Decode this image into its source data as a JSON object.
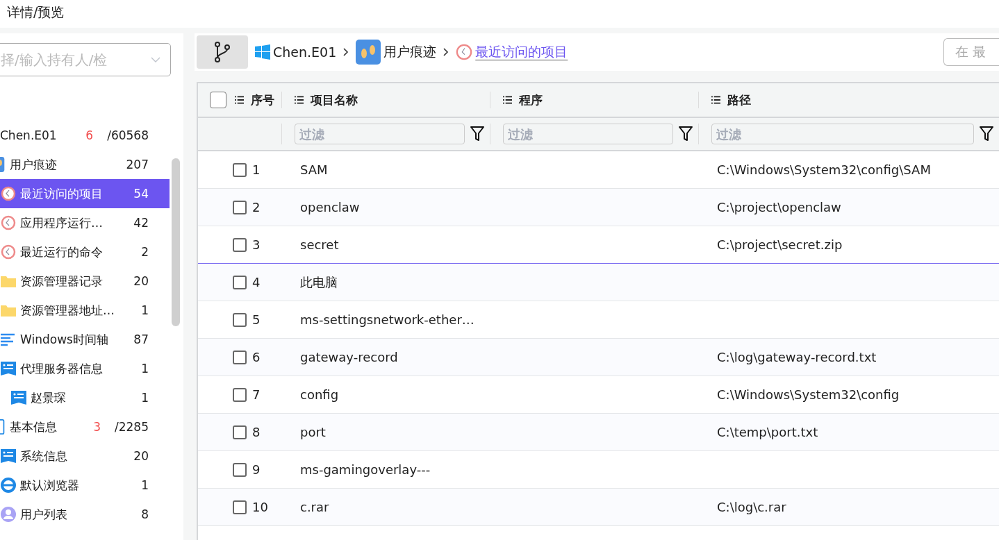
{
  "top_tab": {
    "label": "详情/预览"
  },
  "sidebar": {
    "select": {
      "placeholder": "择/输入持有人/检"
    },
    "tree": [
      {
        "label": "Chen.E01",
        "count_highlight": "6",
        "count": "/60568",
        "selected": false,
        "children": [
          {
            "label": "用户痕迹",
            "count": "207",
            "kind": "footprint",
            "selected": false,
            "children": [
              {
                "label": "最近访问的项目",
                "count": "54",
                "kind": "clock",
                "selected": true
              },
              {
                "label": "应用程序运行…",
                "count": "42",
                "kind": "clock",
                "selected": false
              },
              {
                "label": "最近运行的命令",
                "count": "2",
                "kind": "clock",
                "selected": false
              },
              {
                "label": "资源管理器记录",
                "count": "20",
                "kind": "folder",
                "selected": false
              },
              {
                "label": "资源管理器地址…",
                "count": "1",
                "kind": "folder",
                "selected": false
              },
              {
                "label": "Windows时间轴",
                "count": "87",
                "kind": "timeline",
                "selected": false
              },
              {
                "label": "代理服务器信息",
                "count": "1",
                "kind": "card",
                "selected": false,
                "children": [
                  {
                    "label": "赵景琛",
                    "count": "1",
                    "kind": "card",
                    "selected": false
                  }
                ]
              }
            ]
          },
          {
            "label": "基本信息",
            "count_highlight": "3",
            "count": "/2285",
            "kind": "frame",
            "selected": false,
            "children": [
              {
                "label": "系统信息",
                "count": "20",
                "kind": "card",
                "selected": false
              },
              {
                "label": "默认浏览器",
                "count": "1",
                "kind": "browser",
                "selected": false
              },
              {
                "label": "用户列表",
                "count": "8",
                "kind": "user",
                "selected": false
              }
            ]
          }
        ]
      }
    ]
  },
  "breadcrumb": [
    {
      "label": "Chen.E01",
      "kind": "windows",
      "current": false
    },
    {
      "label": "用户痕迹",
      "kind": "footprint",
      "current": false
    },
    {
      "label": "最近访问的项目",
      "kind": "clock",
      "current": true
    }
  ],
  "search": {
    "placeholder": "在 最"
  },
  "table": {
    "columns": [
      "序号",
      "项目名称",
      "程序",
      "路径"
    ],
    "all_checked": false,
    "filter_placeholders": [
      "过滤",
      "过滤",
      "过滤"
    ],
    "rows": [
      {
        "index": "1",
        "name": "SAM",
        "path": "C:\\Windows\\System32\\config\\SAM",
        "checked": false,
        "hovered": false
      },
      {
        "index": "2",
        "name": "openclaw",
        "path": "C:\\project\\openclaw",
        "checked": false,
        "hovered": false
      },
      {
        "index": "3",
        "name": "secret",
        "path": "C:\\project\\secret.zip",
        "checked": false,
        "hovered": true
      },
      {
        "index": "4",
        "name": "此电脑",
        "checked": false,
        "hovered": false
      },
      {
        "index": "5",
        "name": "ms-settingsnetwork-ether…",
        "checked": false,
        "hovered": false
      },
      {
        "index": "6",
        "name": "gateway-record",
        "path": "C:\\log\\gateway-record.txt",
        "checked": false,
        "hovered": false
      },
      {
        "index": "7",
        "name": "config",
        "path": "C:\\Windows\\System32\\config",
        "checked": false,
        "hovered": false
      },
      {
        "index": "8",
        "name": "port",
        "path": "C:\\temp\\port.txt",
        "checked": false,
        "hovered": false
      },
      {
        "index": "9",
        "name": "ms-gamingoverlay---",
        "checked": false,
        "hovered": false
      },
      {
        "index": "10",
        "name": "c.rar",
        "path": "C:\\log\\c.rar",
        "checked": false,
        "hovered": false
      }
    ]
  }
}
